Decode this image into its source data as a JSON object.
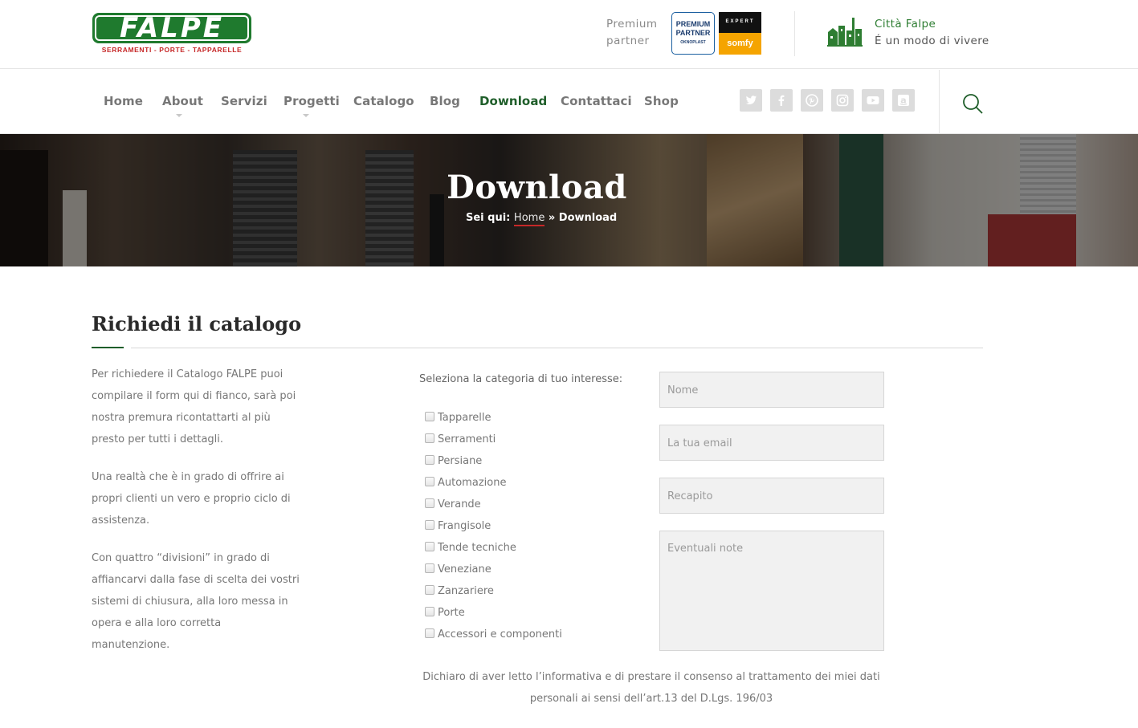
{
  "header": {
    "logo_text": "FALPE",
    "logo_subtitle": "SERRAMENTI - PORTE - TAPPARELLE",
    "premium_line1": "Premium",
    "premium_line2": "partner",
    "badge_premium_line1": "PREMIUM",
    "badge_premium_line2": "PARTNER",
    "badge_premium_brand": "OKNOPLAST",
    "badge_somfy_top": "EXPERT",
    "badge_somfy_brand": "somfy",
    "citta_title": "Città Falpe",
    "citta_subtitle": "É un modo di vivere"
  },
  "nav": {
    "items": [
      {
        "label": "Home",
        "has_submenu": false
      },
      {
        "label": "About",
        "has_submenu": true
      },
      {
        "label": "Servizi",
        "has_submenu": false
      },
      {
        "label": "Progetti",
        "has_submenu": true
      },
      {
        "label": "Catalogo",
        "has_submenu": false
      },
      {
        "label": "Blog",
        "has_submenu": false
      },
      {
        "label": "Download",
        "has_submenu": false,
        "active": true
      },
      {
        "label": "Contattaci",
        "has_submenu": false
      },
      {
        "label": "Shop",
        "has_submenu": false
      }
    ],
    "social_icons": [
      "twitter-icon",
      "facebook-icon",
      "pinterest-icon",
      "instagram-icon",
      "youtube-icon",
      "amazon-icon"
    ],
    "search_icon": "search-icon"
  },
  "hero": {
    "title": "Download",
    "breadcrumb_prefix": "Sei qui:",
    "breadcrumb_home": "Home",
    "breadcrumb_sep": "»",
    "breadcrumb_current": "Download"
  },
  "main": {
    "section_title": "Richiedi il catalogo",
    "intro_paragraphs": [
      "Per richiedere il Catalogo FALPE puoi compilare il form qui di fianco, sarà poi nostra premura ricontattarti al più presto per tutti i dettagli.",
      "Una realtà che è in grado di offrire ai propri clienti un vero e proprio ciclo di assistenza.",
      "Con quattro “divisioni” in grado di affiancarvi dalla fase di scelta dei vostri sistemi di chiusura, alla loro messa in opera e alla loro corretta manutenzione."
    ],
    "category_label": "Seleziona la categoria di tuo interesse:",
    "categories": [
      "Tapparelle",
      "Serramenti",
      "Persiane",
      "Automazione",
      "Verande",
      "Frangisole",
      "Tende tecniche",
      "Veneziane",
      "Zanzariere",
      "Porte",
      "Accessori e componenti"
    ],
    "fields": {
      "name_placeholder": "Nome",
      "email_placeholder": "La tua email",
      "phone_placeholder": "Recapito",
      "notes_placeholder": "Eventuali note"
    },
    "consent_line1": "Dichiaro di aver letto l’informativa e di prestare il consenso al trattamento dei miei dati",
    "consent_line2": "personali ai sensi dell’art.13 del D.Lgs. 196/03"
  },
  "colors": {
    "brand_green": "#1f7a2e",
    "nav_active": "#1f5e2a",
    "accent_red": "#c62828"
  }
}
